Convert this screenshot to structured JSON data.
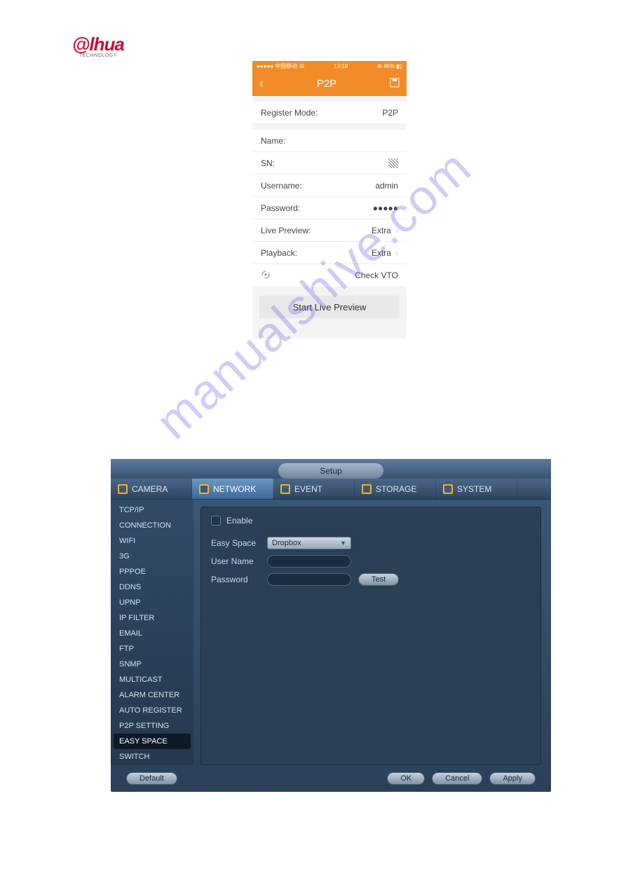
{
  "watermark": "manualshive.com",
  "logo": {
    "brand_at": "@",
    "brand_text": "lhua",
    "sub": "TECHNOLOGY"
  },
  "phone": {
    "status": {
      "left": "●●●●● 中国移动 ⊕",
      "time": "13:18",
      "right": "⊕ 46% ▮▯"
    },
    "header": {
      "back": "‹",
      "title": "P2P",
      "save_icon": "disk"
    },
    "rows": {
      "register_mode": {
        "label": "Register Mode:",
        "value": "P2P"
      },
      "name": {
        "label": "Name:",
        "value": ""
      },
      "sn": {
        "label": "SN:",
        "value_icon": "qr"
      },
      "username": {
        "label": "Username:",
        "value": "admin"
      },
      "password": {
        "label": "Password:",
        "value": "●●●●●"
      },
      "live_preview": {
        "label": "Live Preview:",
        "value": "Extra"
      },
      "playback": {
        "label": "Playback:",
        "value": "Extra"
      },
      "check_vto": {
        "label_icon": "wifi-sync",
        "value": "Check VTO"
      }
    },
    "start_button": "Start Live Preview"
  },
  "web": {
    "top_tab": "Setup",
    "nav": [
      {
        "label": "CAMERA",
        "icon": "camera-icon",
        "active": false
      },
      {
        "label": "NETWORK",
        "icon": "network-icon",
        "active": true
      },
      {
        "label": "EVENT",
        "icon": "event-icon",
        "active": false
      },
      {
        "label": "STORAGE",
        "icon": "storage-icon",
        "active": false
      },
      {
        "label": "SYSTEM",
        "icon": "system-icon",
        "active": false
      }
    ],
    "sidebar": [
      "TCP/IP",
      "CONNECTION",
      "WIFI",
      "3G",
      "PPPOE",
      "DDNS",
      "UPNP",
      "IP FILTER",
      "EMAIL",
      "FTP",
      "SNMP",
      "MULTICAST",
      "ALARM CENTER",
      "AUTO REGISTER",
      "P2P SETTING",
      "EASY SPACE",
      "SWITCH"
    ],
    "sidebar_active": "EASY SPACE",
    "form": {
      "enable_label": "Enable",
      "easy_space": {
        "label": "Easy Space",
        "value": "Dropbox"
      },
      "user_name": {
        "label": "User Name",
        "value": ""
      },
      "password": {
        "label": "Password",
        "value": ""
      },
      "test_button": "Test"
    },
    "footer": {
      "default": "Default",
      "ok": "OK",
      "cancel": "Cancel",
      "apply": "Apply"
    }
  }
}
